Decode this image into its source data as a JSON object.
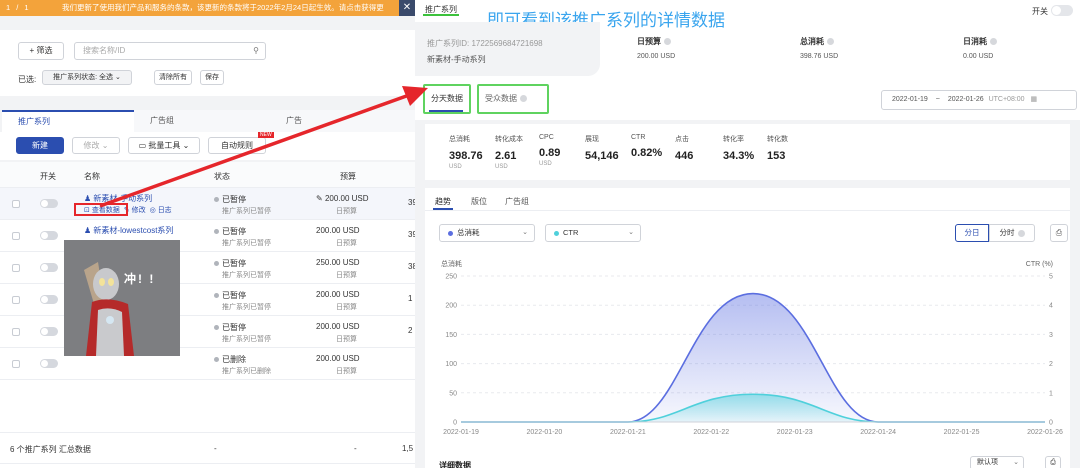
{
  "notice": {
    "pager": "1 / 1",
    "text": "我们更新了使用我们产品和服务的条款，该更新的条款将于2022年2月24日起生效。请点击获得更",
    "close": "✕"
  },
  "filter": {
    "add_filter": "+ 筛选",
    "search_placeholder": "搜索名称/ID",
    "selected_label": "已选:",
    "status_chip": "推广系列状态: 全选",
    "clear_all": "清除所有",
    "save": "保存"
  },
  "left_tabs": [
    "推广系列",
    "广告组",
    "广告"
  ],
  "toolbar": {
    "create": "新建",
    "edit": "修改",
    "bulk_tools": "批量工具",
    "auto_rules": "自动规则",
    "new_badge": "NEW"
  },
  "table": {
    "headers": {
      "switch": "开关",
      "name": "名称",
      "status": "状态",
      "budget": "预算"
    },
    "rows": [
      {
        "name": "新素材-手动系列",
        "actions": [
          "查看数据",
          "修改",
          "日志"
        ],
        "status": "已暂停",
        "status_sub": "推广系列已暂停",
        "budget": "200.00 USD",
        "budget_sub": "日预算",
        "extra": "39"
      },
      {
        "name": "新素材-lowestcost系列",
        "actions": [],
        "status": "已暂停",
        "status_sub": "推广系列已暂停",
        "budget": "200.00 USD",
        "budget_sub": "日预算",
        "extra": "39"
      },
      {
        "name": "",
        "actions": [],
        "status": "已暂停",
        "status_sub": "推广系列已暂停",
        "budget": "250.00 USD",
        "budget_sub": "日预算",
        "extra": "38"
      },
      {
        "name": "",
        "actions": [],
        "status": "已暂停",
        "status_sub": "推广系列已暂停",
        "budget": "200.00 USD",
        "budget_sub": "日预算",
        "extra": "1"
      },
      {
        "name": "",
        "actions": [],
        "status": "已暂停",
        "status_sub": "推广系列已暂停",
        "budget": "200.00 USD",
        "budget_sub": "日预算",
        "extra": "2"
      },
      {
        "name": "",
        "actions": [],
        "status": "已删除",
        "status_sub": "推广系列已删除",
        "budget": "200.00 USD",
        "budget_sub": "日预算",
        "extra": ""
      }
    ],
    "summary": {
      "label": "6 个推广系列 汇总数据",
      "status": "-",
      "budget": "-",
      "extra": "1,5"
    }
  },
  "sticker": {
    "text": "冲! !"
  },
  "detail": {
    "title": "推广系列",
    "annotation": "即可看到该推广系列的详情数据",
    "switch_label": "开关",
    "campaign_id": "推广系列ID: 1722569684721698",
    "campaign_name": "新素材-手动系列",
    "info": [
      {
        "label": "日预算",
        "value": "200.00 USD"
      },
      {
        "label": "总消耗",
        "value": "398.76 USD"
      },
      {
        "label": "日消耗",
        "value": "0.00 USD"
      }
    ],
    "subtabs": [
      "分天数据",
      "受众数据"
    ],
    "date_start": "2022-01-19",
    "date_sep": "~",
    "date_end": "2022-01-26",
    "timezone": "UTC+08:00",
    "kpis": [
      {
        "label": "总消耗",
        "value": "398.76",
        "unit": "USD"
      },
      {
        "label": "转化成本",
        "value": "2.61",
        "unit": "USD"
      },
      {
        "label": "CPC",
        "value": "0.89",
        "unit": "USD"
      },
      {
        "label": "展现",
        "value": "54,146",
        "unit": ""
      },
      {
        "label": "CTR",
        "value": "0.82%",
        "unit": ""
      },
      {
        "label": "点击",
        "value": "446",
        "unit": ""
      },
      {
        "label": "转化率",
        "value": "34.3%",
        "unit": ""
      },
      {
        "label": "转化数",
        "value": "153",
        "unit": ""
      }
    ],
    "chart_tabs": [
      "趋势",
      "版位",
      "广告组"
    ],
    "metric_left": "总消耗",
    "metric_right": "CTR",
    "seg_day": "分日",
    "seg_hour": "分时",
    "detail_title": "详细数据",
    "detail_sort": "默认项"
  },
  "colors": {
    "accent": "#2b4eb0",
    "series_spend": "#5b6ee0",
    "series_ctr": "#4fd0db",
    "notice": "#f3a33b",
    "annotation": "#3aa5ee",
    "highlight_green": "#5fd35f",
    "highlight_red": "#e5262b"
  },
  "chart_data": {
    "type": "area",
    "x": [
      "2022-01-19",
      "2022-01-20",
      "2022-01-21",
      "2022-01-22",
      "2022-01-23",
      "2022-01-24",
      "2022-01-25",
      "2022-01-26"
    ],
    "series": [
      {
        "name": "总消耗",
        "axis": "left",
        "values": [
          0,
          0,
          0,
          201,
          197,
          0,
          0,
          0
        ],
        "peak": {
          "x": "2022-01-22",
          "value": 220
        }
      },
      {
        "name": "CTR",
        "axis": "right",
        "values": [
          0,
          0,
          0,
          0.8,
          0.83,
          0,
          0,
          0
        ],
        "peak": {
          "x": "2022-01-22",
          "value": 0.95
        }
      }
    ],
    "ylabel_left": "总消耗",
    "ylabel_right": "CTR (%)",
    "ylim_left": [
      0,
      250
    ],
    "yticks_left": [
      0,
      50,
      100,
      150,
      200,
      250
    ],
    "ylim_right": [
      0,
      5
    ],
    "yticks_right": [
      0,
      1,
      2,
      3,
      4,
      5
    ],
    "grid": true
  }
}
